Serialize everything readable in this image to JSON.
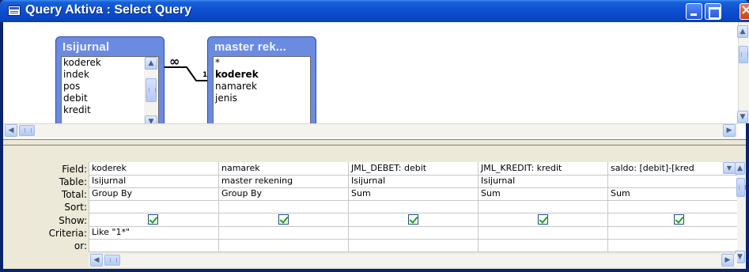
{
  "window": {
    "title": "Query Aktiva : Select Query",
    "icon": "query-icon"
  },
  "tables": [
    {
      "name": "Isijurnal",
      "fields": [
        "koderek",
        "indek",
        "pos",
        "debit",
        "kredit"
      ]
    },
    {
      "name": "master rek...",
      "fields": [
        "*",
        "koderek",
        "namarek",
        "jenis"
      ],
      "key_field": "koderek"
    }
  ],
  "join": {
    "left_symbol": "∞",
    "right_symbol": "1"
  },
  "grid": {
    "row_labels": [
      "Field:",
      "Table:",
      "Total:",
      "Sort:",
      "Show:",
      "Criteria:",
      "or:"
    ],
    "columns": [
      {
        "field": "koderek",
        "table": "Isijurnal",
        "total": "Group By",
        "sort": "",
        "show": true,
        "criteria": "Like \"1*\"",
        "or": ""
      },
      {
        "field": "namarek",
        "table": "master rekening",
        "total": "Group By",
        "sort": "",
        "show": true,
        "criteria": "",
        "or": ""
      },
      {
        "field": "JML_DEBET: debit",
        "table": "Isijurnal",
        "total": "Sum",
        "sort": "",
        "show": true,
        "criteria": "",
        "or": ""
      },
      {
        "field": "JML_KREDIT: kredit",
        "table": "Isijurnal",
        "total": "Sum",
        "sort": "",
        "show": true,
        "criteria": "",
        "or": ""
      },
      {
        "field": "saldo: [debit]-[kred",
        "table": "",
        "total": "Sum",
        "sort": "",
        "show": true,
        "criteria": "",
        "or": ""
      }
    ]
  },
  "colors": {
    "titlebar": "#0c4fd0",
    "fieldlist_header": "#6b8be0",
    "checkmark": "#21a121"
  }
}
